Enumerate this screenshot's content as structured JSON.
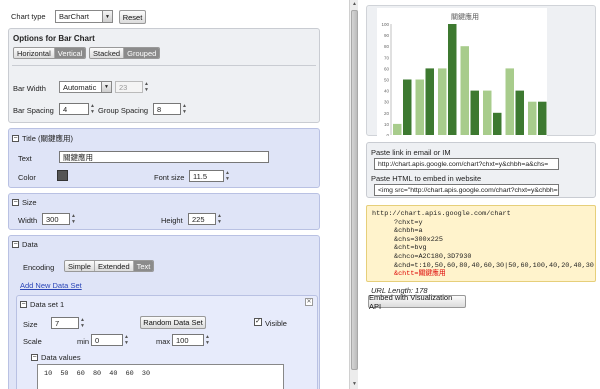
{
  "top": {
    "chart_type_label": "Chart type",
    "chart_type_value": "BarChart",
    "reset_label": "Reset"
  },
  "options": {
    "title": "Options for Bar Chart",
    "orientation": [
      "Horizontal",
      "Vertical"
    ],
    "orientation_selected": "Vertical",
    "stacking": [
      "Stacked",
      "Grouped"
    ],
    "stacking_selected": "Grouped",
    "bar_width_label": "Bar Width",
    "bar_width_value": "Automatic",
    "bar_width_number": "23",
    "bar_spacing_label": "Bar Spacing",
    "bar_spacing_value": "4",
    "group_spacing_label": "Group Spacing",
    "group_spacing_value": "8"
  },
  "title_section": {
    "header": "Title (關鍵應用)",
    "text_label": "Text",
    "text_value": "關鍵應用",
    "color_label": "Color",
    "color_swatch": "#555555",
    "font_size_label": "Font size",
    "font_size_value": "11.5"
  },
  "size_section": {
    "header": "Size",
    "width_label": "Width",
    "width_value": "300",
    "height_label": "Height",
    "height_value": "225"
  },
  "data_section": {
    "header": "Data",
    "encoding_label": "Encoding",
    "encodings": [
      "Simple",
      "Extended",
      "Text"
    ],
    "encoding_selected": "Text",
    "add_link": "Add New Data Set",
    "dataset": {
      "header": "Data set 1",
      "size_label": "Size",
      "size_value": "7",
      "random_label": "Random Data Set",
      "visible_label": "Visible",
      "scale_label": "Scale",
      "min_label": "min",
      "min_value": "0",
      "max_label": "max",
      "max_value": "100",
      "values_header": "Data values",
      "values_text": "10  50  60  80  40  60  30"
    }
  },
  "chart": {
    "title": "關鍵應用",
    "colors": {
      "light": "#a8cc8c",
      "dark": "#3d7930"
    },
    "chart_data": {
      "type": "bar",
      "title": "關鍵應用",
      "series": [
        {
          "values": [
            10,
            50,
            60,
            80,
            40,
            60,
            30
          ],
          "color": "#a8cc8c"
        },
        {
          "values": [
            50,
            60,
            100,
            40,
            20,
            40,
            30
          ],
          "color": "#3d7930"
        }
      ],
      "ylim": [
        0,
        100
      ],
      "yticks": [
        "0",
        "10",
        "20",
        "30",
        "40",
        "50",
        "60",
        "70",
        "80",
        "90",
        "100"
      ]
    }
  },
  "share": {
    "link_label": "Paste link in email or IM",
    "link_value": "http://chart.apis.google.com/chart?chxt=y&chbh=a&chs=",
    "html_label": "Paste HTML to embed in website",
    "html_value": "<img src=\"http://chart.apis.google.com/chart?chxt=y&chbh="
  },
  "url_box": {
    "base": "http://chart.apis.google.com/chart",
    "params": [
      "?chxt=y",
      "&chbh=a",
      "&chs=300x225",
      "&cht=bvg",
      "&chco=A2C180,3D7930",
      "&chd=t:10,50,60,80,40,60,30|50,60,100,40,20,40,30"
    ],
    "highlight": "&chtt=關鍵應用",
    "url_length": "URL Length: 178",
    "embed_label": "Embed with Visualization API"
  }
}
